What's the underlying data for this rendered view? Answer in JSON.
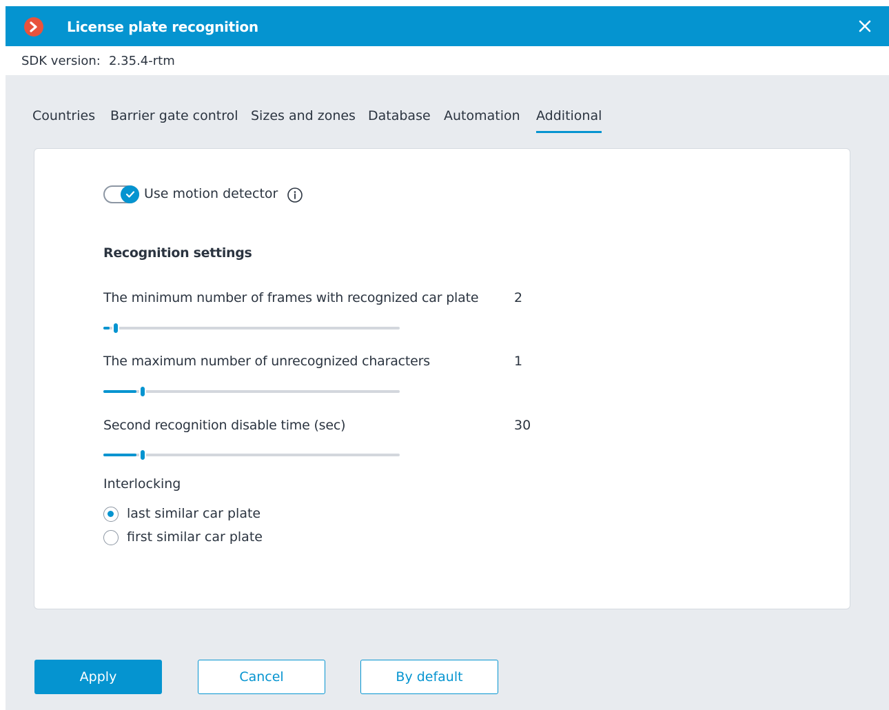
{
  "window": {
    "title": "License plate recognition",
    "accent_color": "#0594d0",
    "logo_color": "#e8533c",
    "logo_icon": "chevron-right-icon",
    "close_icon": "close-icon"
  },
  "sdk": {
    "label": "SDK version:",
    "value": "2.35.4-rtm"
  },
  "tabs": [
    {
      "label": "Countries",
      "active": false
    },
    {
      "label": "Barrier gate control",
      "active": false
    },
    {
      "label": "Sizes and zones",
      "active": false
    },
    {
      "label": "Database",
      "active": false
    },
    {
      "label": "Automation",
      "active": false
    },
    {
      "label": "Additional",
      "active": true
    }
  ],
  "motion_detector": {
    "label": "Use motion detector",
    "enabled": true,
    "info_icon": "info-icon"
  },
  "recognition": {
    "section_title": "Recognition settings",
    "sliders": [
      {
        "label": "The minimum number of frames with recognized car plate",
        "value": "2",
        "level": 0.03
      },
      {
        "label": "The maximum number of unrecognized characters",
        "value": "1",
        "level": 0.12
      },
      {
        "label": "Second recognition disable time (sec)",
        "value": "30",
        "level": 0.12
      }
    ]
  },
  "interlocking": {
    "label": "Interlocking",
    "options": [
      {
        "label": "last similar car plate",
        "checked": true
      },
      {
        "label": "first similar car plate",
        "checked": false
      }
    ]
  },
  "buttons": {
    "apply": "Apply",
    "cancel": "Cancel",
    "default": "By default"
  }
}
